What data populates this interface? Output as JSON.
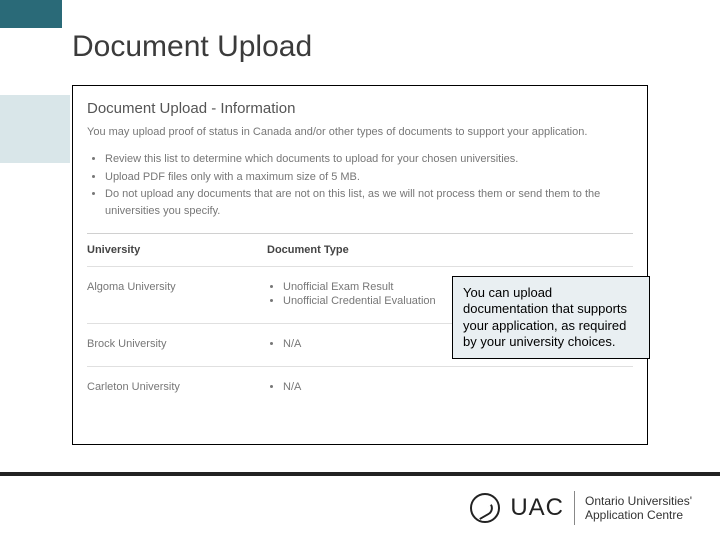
{
  "slide_title": "Document Upload",
  "panel": {
    "heading": "Document Upload - Information",
    "intro": "You may upload proof of status in Canada and/or other types of documents to support your application.",
    "instructions": [
      "Review this list to determine which documents to upload for your chosen universities.",
      "Upload PDF files only with a maximum size of 5 MB.",
      "Do not upload any documents that are not on this list, as we will not process them or send them to the universities you specify."
    ],
    "columns": {
      "university": "University",
      "doc_type": "Document Type"
    },
    "rows": [
      {
        "university": "Algoma University",
        "docs": [
          "Unofficial Exam Result",
          "Unofficial Credential Evaluation"
        ]
      },
      {
        "university": "Brock University",
        "docs": [
          "N/A"
        ]
      },
      {
        "university": "Carleton University",
        "docs": [
          "N/A"
        ]
      }
    ]
  },
  "callout": "You can upload documentation that supports your application, as required by your university choices.",
  "footer": {
    "brand": "UAC",
    "sub1": "Ontario Universities'",
    "sub2": "Application Centre"
  }
}
